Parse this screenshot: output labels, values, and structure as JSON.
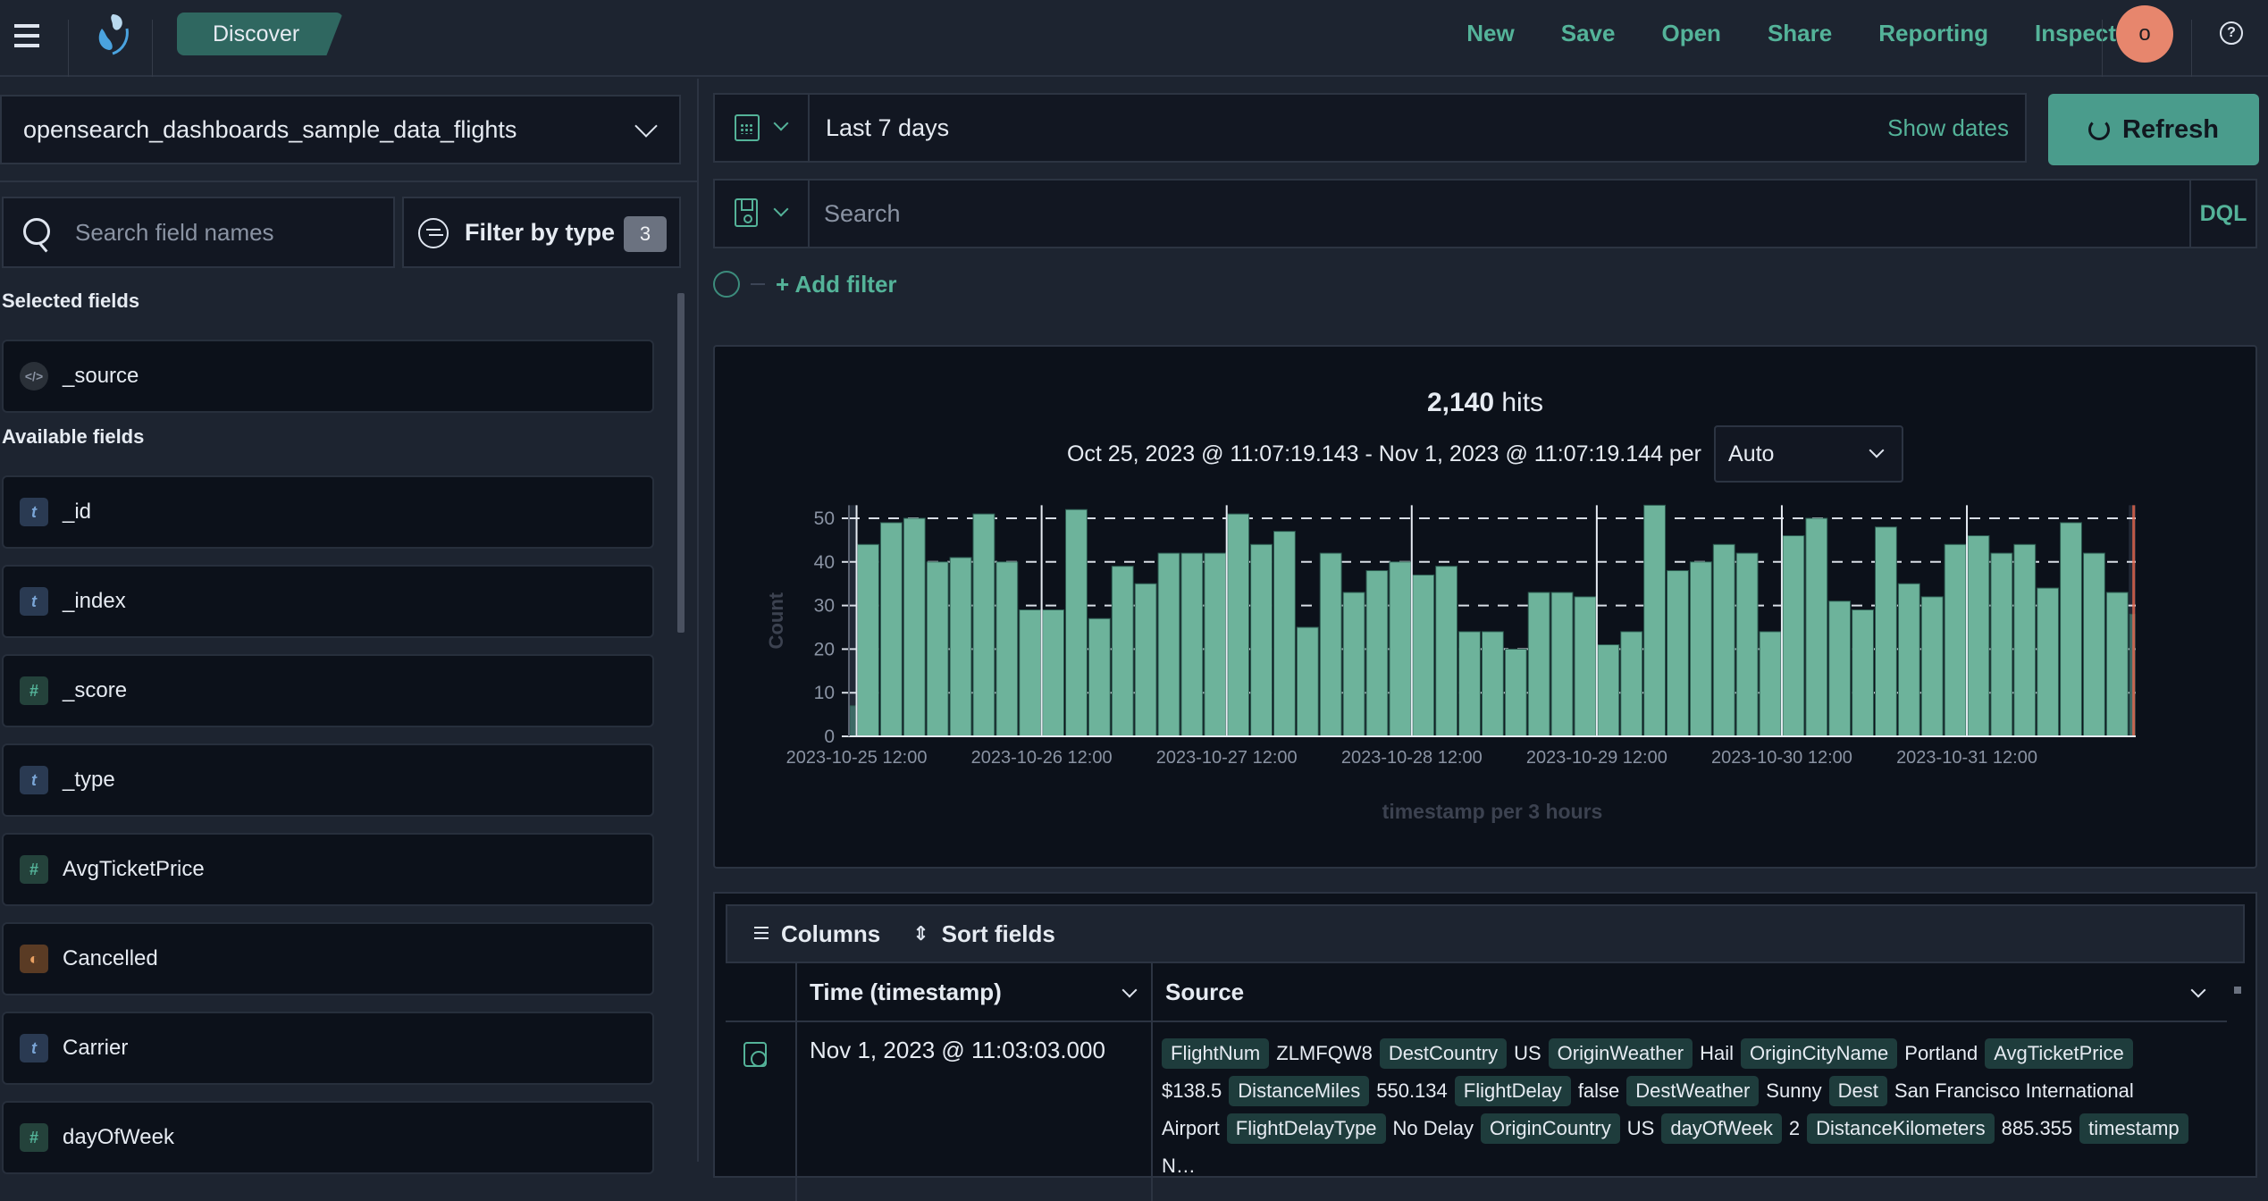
{
  "header": {
    "app_name": "OpenSearch Dashboards",
    "breadcrumb": "Discover",
    "nav": [
      "New",
      "Save",
      "Open",
      "Share",
      "Reporting",
      "Inspect"
    ],
    "avatar_initial": "o",
    "help_icon": "?"
  },
  "sidebar": {
    "index_pattern": "opensearch_dashboards_sample_data_flights",
    "search_placeholder": "Search field names",
    "filter_label": "Filter by type",
    "filter_count": "3",
    "selected_title": "Selected fields",
    "selected_fields": [
      {
        "name": "_source",
        "type": "source"
      }
    ],
    "available_title": "Available fields",
    "available_fields": [
      {
        "name": "_id",
        "type": "t"
      },
      {
        "name": "_index",
        "type": "t"
      },
      {
        "name": "_score",
        "type": "#"
      },
      {
        "name": "_type",
        "type": "t"
      },
      {
        "name": "AvgTicketPrice",
        "type": "#"
      },
      {
        "name": "Cancelled",
        "type": "boolean"
      },
      {
        "name": "Carrier",
        "type": "t"
      },
      {
        "name": "dayOfWeek",
        "type": "#"
      }
    ]
  },
  "query": {
    "time_range": "Last 7 days",
    "show_dates": "Show dates",
    "refresh_label": "Refresh",
    "search_placeholder": "Search",
    "language": "DQL",
    "add_filter": "+ Add filter"
  },
  "histogram": {
    "hits_count": "2,140",
    "hits_label": "hits",
    "range_text": "Oct 25, 2023 @ 11:07:19.143 - Nov 1, 2023 @ 11:07:19.144 per",
    "interval": "Auto"
  },
  "chart_data": {
    "type": "bar",
    "title": "",
    "xlabel": "timestamp per 3 hours",
    "ylabel": "Count",
    "ylim": [
      0,
      53
    ],
    "yticks": [
      0,
      10,
      20,
      30,
      40,
      50
    ],
    "grid": "horizontal-dashed",
    "legend": "none",
    "bucket": "3 hours",
    "x_tick_labels": [
      "2023-10-25 12:00",
      "2023-10-26 12:00",
      "2023-10-27 12:00",
      "2023-10-28 12:00",
      "2023-10-29 12:00",
      "2023-10-30 12:00",
      "2023-10-31 12:00"
    ],
    "start_bucket": "2023-10-25 09:00",
    "values": [
      7,
      44,
      49,
      50,
      40,
      41,
      51,
      40,
      29,
      29,
      52,
      27,
      39,
      35,
      42,
      42,
      42,
      51,
      44,
      47,
      25,
      42,
      33,
      38,
      40,
      37,
      39,
      24,
      24,
      20,
      33,
      33,
      32,
      21,
      24,
      53,
      38,
      40,
      44,
      42,
      24,
      46,
      50,
      31,
      29,
      48,
      35,
      32,
      44,
      46,
      42,
      44,
      34,
      49,
      42,
      33,
      28
    ],
    "partial_first": true,
    "partial_last": true,
    "colors": {
      "bar": "#6db39b",
      "partial": "#3d6a66",
      "now_marker": "#e7664c"
    }
  },
  "documents": {
    "toolbar": {
      "columns": "Columns",
      "sort": "Sort fields"
    },
    "headers": [
      "Time (timestamp)",
      "Source"
    ],
    "rows": [
      {
        "time": "Nov 1, 2023 @ 11:03:03.000",
        "source": [
          [
            "FlightNum",
            "ZLMFQW8"
          ],
          [
            "DestCountry",
            "US"
          ],
          [
            "OriginWeather",
            "Hail"
          ],
          [
            "OriginCityName",
            "Portland"
          ],
          [
            "AvgTicketPrice",
            "$138.5"
          ],
          [
            "DistanceMiles",
            "550.134"
          ],
          [
            "FlightDelay",
            "false"
          ],
          [
            "DestWeather",
            "Sunny"
          ],
          [
            "Dest",
            "San Francisco International Airport"
          ],
          [
            "FlightDelayType",
            "No Delay"
          ],
          [
            "OriginCountry",
            "US"
          ],
          [
            "dayOfWeek",
            "2"
          ],
          [
            "DistanceKilometers",
            "885.355"
          ],
          [
            "timestamp",
            "N…"
          ]
        ]
      }
    ]
  }
}
